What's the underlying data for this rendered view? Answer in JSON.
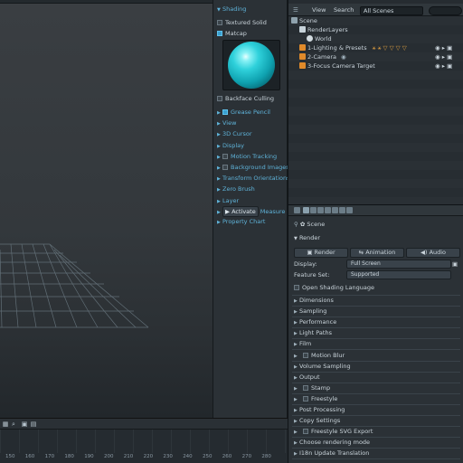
{
  "shading": {
    "section": "Shading",
    "textured_solid": "Textured Solid",
    "matcap": "Matcap",
    "backface_culling": "Backface Culling"
  },
  "tool_sections": [
    "Grease Pencil",
    "View",
    "3D Cursor",
    "Display",
    "Motion Tracking",
    "Background Images",
    "Transform Orientations",
    "Zero Brush",
    "Layer"
  ],
  "activate_label": "Activate",
  "measure_label": "Measure",
  "property_chart_label": "Property Chart",
  "outliner": {
    "view_menu": "View",
    "search_menu": "Search",
    "scenes_select": "All Scenes",
    "rows": [
      "Scene",
      "RenderLayers",
      "World",
      "1-Lighting & Presets",
      "2-Camera",
      "3-Focus Camera Target"
    ]
  },
  "properties": {
    "scene_crumb": "Scene",
    "render_panel": "Render",
    "tabs": [
      "Render",
      "Animation",
      "Audio"
    ],
    "display_label": "Display:",
    "display_value": "Full Screen",
    "feature_set_label": "Feature Set:",
    "feature_set_value": "Supported",
    "osl_label": "Open Shading Language",
    "panels": [
      "Dimensions",
      "Sampling",
      "Performance",
      "Light Paths",
      "Film",
      "Motion Blur",
      "Volume Sampling",
      "Output",
      "Stamp",
      "Freestyle",
      "Post Processing",
      "Copy Settings",
      "Freestyle SVG Export",
      "Choose rendering mode",
      "I18n Update Translation"
    ]
  },
  "timeline_ticks": [
    "150",
    "160",
    "170",
    "180",
    "190",
    "200",
    "210",
    "220",
    "230",
    "240",
    "250",
    "260",
    "270",
    "280"
  ],
  "colors": {
    "accent": "#5fb3d9",
    "matcap": "#1fc4cf"
  }
}
